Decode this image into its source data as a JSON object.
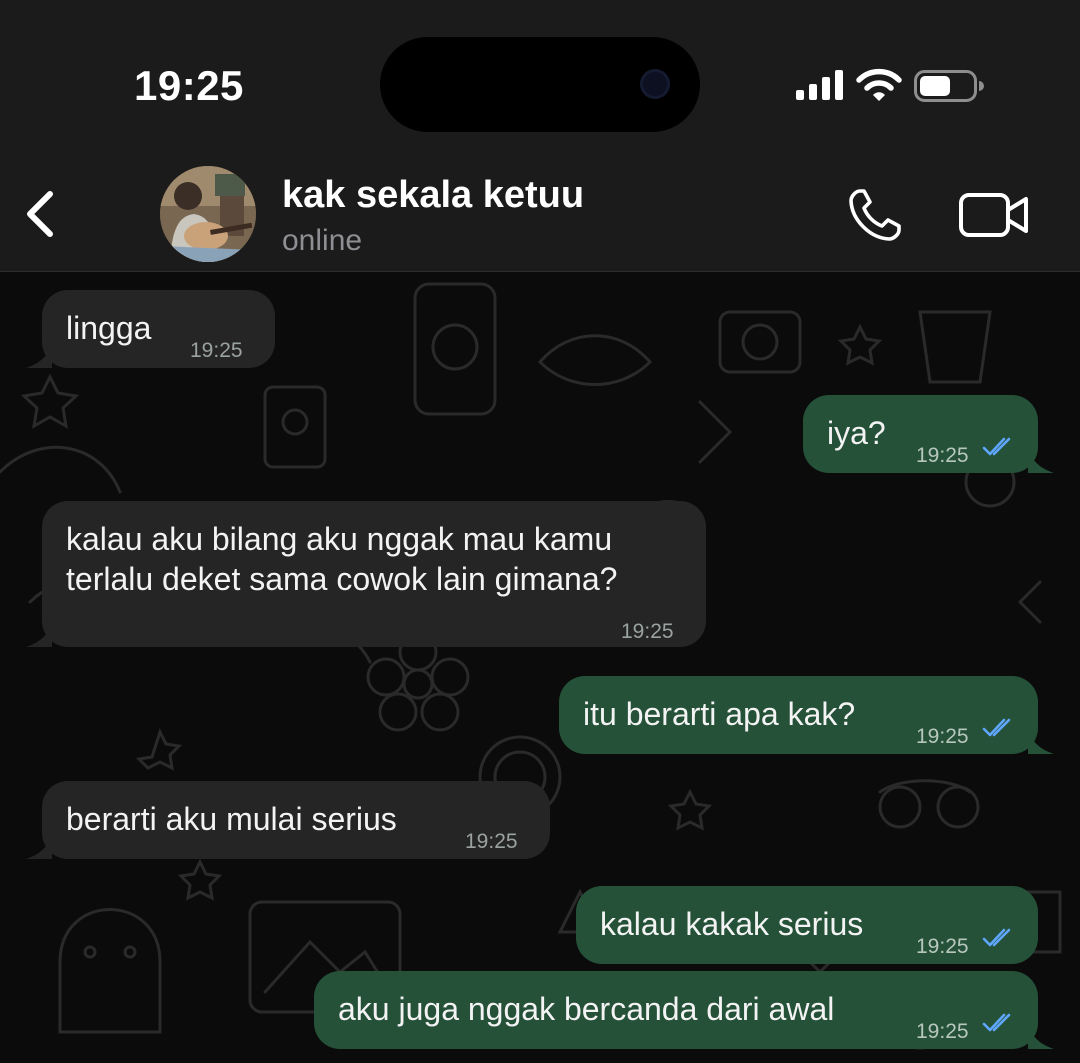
{
  "status_bar": {
    "time": "19:25"
  },
  "header": {
    "contact_name": "kak sekala ketuu",
    "contact_status": "online",
    "icons": [
      "back-icon",
      "phone-icon",
      "video-camera-icon"
    ]
  },
  "colors": {
    "incoming_bubble": "#252525",
    "outgoing_bubble": "#245138",
    "read_receipt": "#5fa7ff",
    "background": "#0b0b0b",
    "header": "#1b1b1b"
  },
  "messages": [
    {
      "direction": "in",
      "text": "lingga",
      "time": "19:25"
    },
    {
      "direction": "out",
      "text": "iya?",
      "time": "19:25",
      "status": "read"
    },
    {
      "direction": "in",
      "text_lines": [
        "kalau aku bilang aku nggak mau kamu",
        "terlalu deket sama cowok lain gimana?"
      ],
      "time": "19:25"
    },
    {
      "direction": "out",
      "text": "itu berarti apa kak?",
      "time": "19:25",
      "status": "read"
    },
    {
      "direction": "in",
      "text": "berarti aku mulai serius",
      "time": "19:25"
    },
    {
      "direction": "out",
      "text": "kalau kakak serius",
      "time": "19:25",
      "status": "read"
    },
    {
      "direction": "out",
      "text": "aku juga nggak bercanda dari awal",
      "time": "19:25",
      "status": "read"
    }
  ]
}
